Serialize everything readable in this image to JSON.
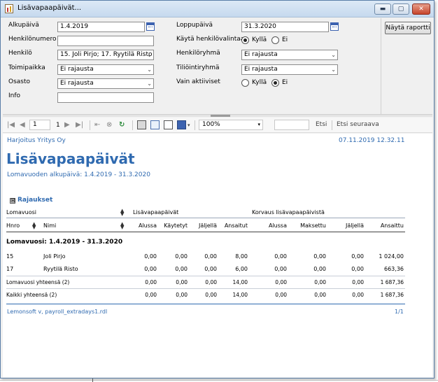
{
  "window": {
    "title": "Lisävapaapäivät..."
  },
  "window_buttons": {
    "minimize": "▬",
    "maximize": "▢",
    "close": "✕"
  },
  "params": {
    "alkupaiva_label": "Alkupäivä",
    "alkupaiva_value": "1.4.2019",
    "henkilonumero_label": "Henkilönumero",
    "henkilonumero_value": "",
    "henkilo_label": "Henkilö",
    "henkilo_value": "15. Joli Pirjo; 17. Ryytilä Risto",
    "toimipaikka_label": "Toimipaikka",
    "toimipaikka_value": "Ei rajausta",
    "osasto_label": "Osasto",
    "osasto_value": "Ei rajausta",
    "info_label": "Info",
    "info_value": "",
    "loppupaiva_label": "Loppupäivä",
    "loppupaiva_value": "31.3.2020",
    "kayta_label": "Käytä henkilövalintaa",
    "kylla": "Kyllä",
    "ei": "Ei",
    "henkiloryhma_label": "Henkilöryhmä",
    "henkiloryhma_value": "Ei rajausta",
    "tiliointiryhma_label": "Tiliöintiryhmä",
    "tiliointiryhma_value": "Ei rajausta",
    "vain_label": "Vain aktiiviset",
    "report_button": "Näytä raportti"
  },
  "toolbar": {
    "first": "|◀",
    "prev": "◀",
    "page": "1",
    "of": "1",
    "next": "▶",
    "last": "▶|",
    "back": "⇤",
    "stop": "⊗",
    "refresh": "↻",
    "zoom": "100%",
    "find": "Etsi",
    "find_next": "Etsi seuraava"
  },
  "report": {
    "company": "Harjoitus Yritys Oy",
    "date": "07.11.2019 12.32.11",
    "title": "Lisävapaapäivät",
    "subtitle": "Lomavuoden alkupäivä: 1.4.2019 - 31.3.2020",
    "filter_toggle": "⊞",
    "filter_label": "Rajaukset",
    "group1": "Lomavuosi",
    "group2": "Lisävapaapäivät",
    "group3": "Korvaus lisävapaapäivistä",
    "columns": [
      "Hnro",
      "Nimi",
      "Alussa",
      "Käytetyt",
      "Jäljellä",
      "Ansaitut",
      "Alussa",
      "Maksettu",
      "Jäljellä",
      "Ansaittu"
    ],
    "section": "Lomavuosi: 1.4.2019 - 31.3.2020",
    "rows": [
      [
        "15",
        "Joli Pirjo",
        "0,00",
        "0,00",
        "0,00",
        "8,00",
        "0,00",
        "0,00",
        "0,00",
        "1 024,00"
      ],
      [
        "17",
        "Ryytilä Risto",
        "0,00",
        "0,00",
        "0,00",
        "6,00",
        "0,00",
        "0,00",
        "0,00",
        "663,36"
      ]
    ],
    "subtotal": [
      "Lomavuosi yhteensä (2)",
      "0,00",
      "0,00",
      "0,00",
      "14,00",
      "0,00",
      "0,00",
      "0,00",
      "1 687,36"
    ],
    "total": [
      "Kaikki yhteensä (2)",
      "0,00",
      "0,00",
      "0,00",
      "14,00",
      "0,00",
      "0,00",
      "0,00",
      "1 687,36"
    ],
    "footer": "Lemonsoft v, payroll_extradays1.rdl",
    "page": "1/1"
  }
}
